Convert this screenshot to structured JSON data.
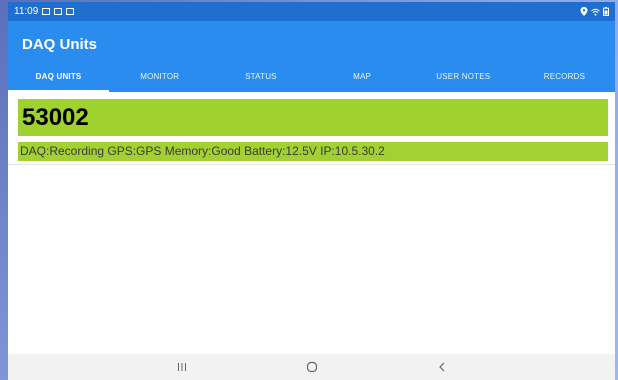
{
  "statusbar": {
    "time": "11:09"
  },
  "app": {
    "title": "DAQ Units"
  },
  "tabs": [
    {
      "label": "DAQ UNITS"
    },
    {
      "label": "MONITOR"
    },
    {
      "label": "STATUS"
    },
    {
      "label": "MAP"
    },
    {
      "label": "USER NOTES"
    },
    {
      "label": "RECORDS"
    }
  ],
  "unit": {
    "id": "53002",
    "status_line": "DAQ:Recording GPS:GPS Memory:Good Battery:12.5V IP:10.5.30.2"
  },
  "colors": {
    "appbar": "#2b8cf0",
    "statusbar": "#1e6fd0",
    "unit_bg": "#9fd12f"
  },
  "icons": [
    "gallery-icon",
    "screenshot-icon",
    "photo-icon",
    "location-icon",
    "wifi-icon",
    "battery-icon",
    "recents-icon",
    "home-icon",
    "back-icon"
  ]
}
